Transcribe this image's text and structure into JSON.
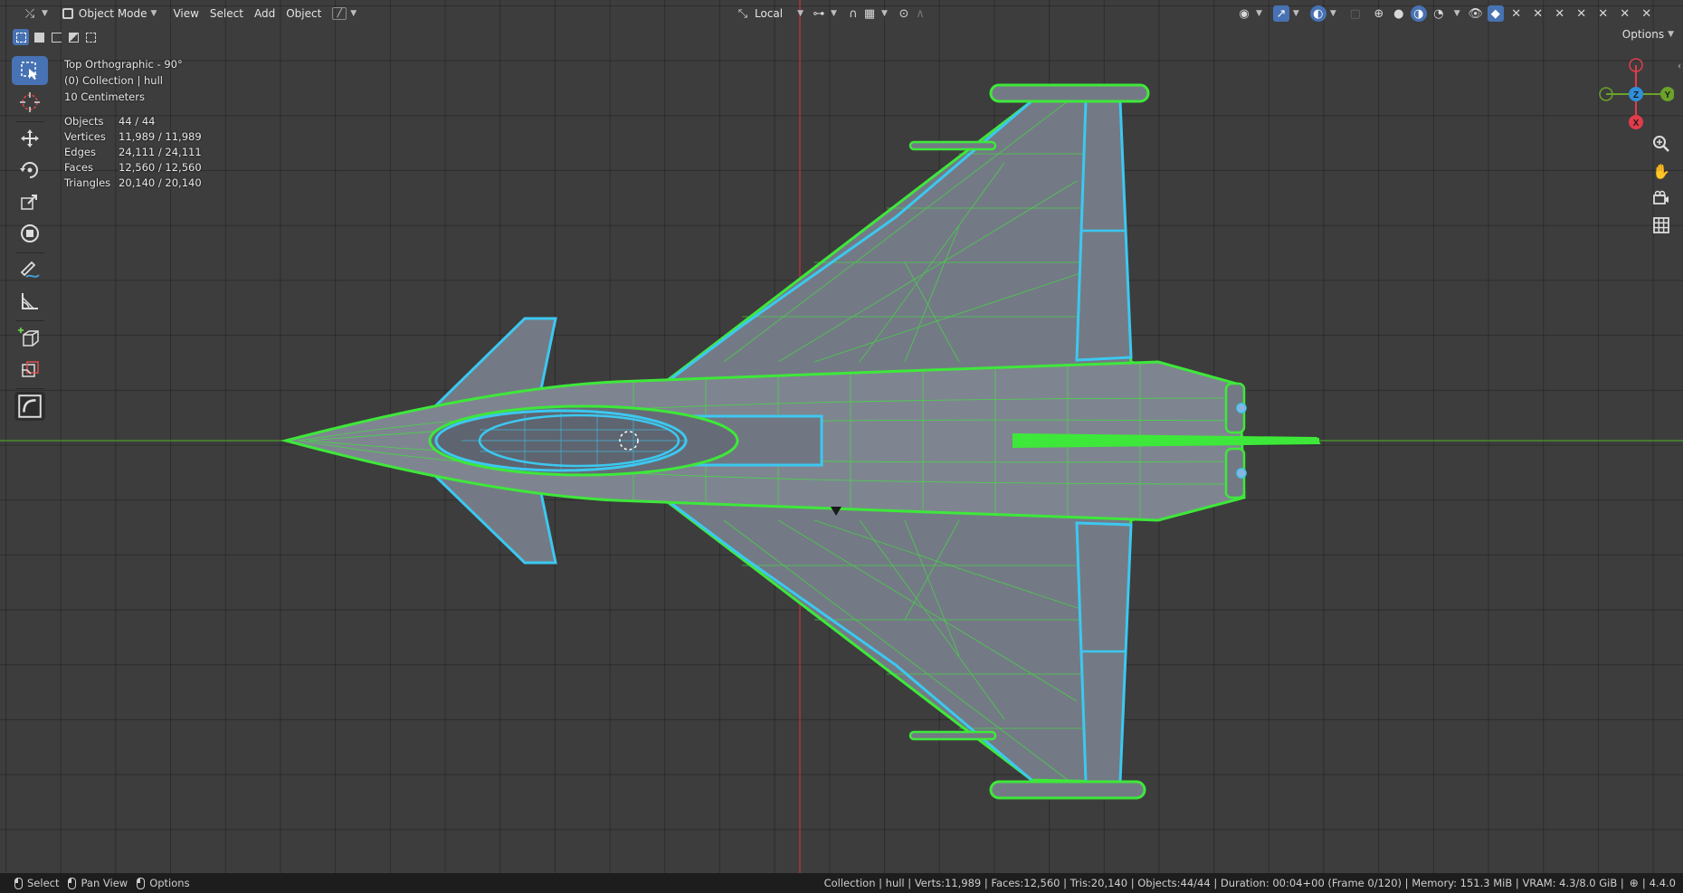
{
  "header": {
    "editor_type_icon": "axis-editor-icon",
    "mode_label": "Object Mode",
    "menus": [
      "View",
      "Select",
      "Add",
      "Object"
    ],
    "transform_orientation": "Local",
    "options_label": "Options"
  },
  "overlay": {
    "view_name": "Top Orthographic - 90°",
    "collection": "(0) Collection | hull",
    "grid_scale": "10 Centimeters"
  },
  "stats": [
    {
      "label": "Objects",
      "value": "44 / 44"
    },
    {
      "label": "Vertices",
      "value": "11,989 / 11,989"
    },
    {
      "label": "Edges",
      "value": "24,111 / 24,111"
    },
    {
      "label": "Faces",
      "value": "12,560 / 12,560"
    },
    {
      "label": "Triangles",
      "value": "20,140 / 20,140"
    }
  ],
  "toolbar": {
    "tools": [
      "select-box-icon",
      "cursor-icon",
      "move-icon",
      "rotate-icon",
      "scale-icon",
      "transform-icon",
      "annotate-icon",
      "measure-icon",
      "add-cube-icon",
      "add-cube-tool-icon",
      "shear-icon"
    ],
    "active": "select-box-icon"
  },
  "gizmo": {
    "axes": [
      {
        "label": "Z",
        "color": "#2e8fdb"
      },
      {
        "label": "Y",
        "color": "#6aa22a"
      },
      {
        "label": "X",
        "color": "#e23c4c"
      }
    ],
    "center_label": "Z"
  },
  "colors": {
    "viewport_bg": "#3d3d3d",
    "selected_outline": "#3ee83a",
    "active_outline": "#3cc8f0",
    "x_axis": "#c8323c",
    "y_axis": "#4aa02a"
  },
  "statusbar": {
    "left": [
      {
        "icon": "mouse-left-icon",
        "label": "Select"
      },
      {
        "icon": "mouse-middle-icon",
        "label": "Pan View"
      },
      {
        "icon": "mouse-right-icon",
        "label": "Options"
      }
    ],
    "scene_info": "Collection | hull | Verts:11,989 | Faces:12,560 | Tris:20,140 | Objects:44/44 | Duration: 00:04+00 (Frame 0/120) | Memory: 151.3 MiB | VRAM: 4.3/8.0 GiB |",
    "version": "4.4.0"
  }
}
